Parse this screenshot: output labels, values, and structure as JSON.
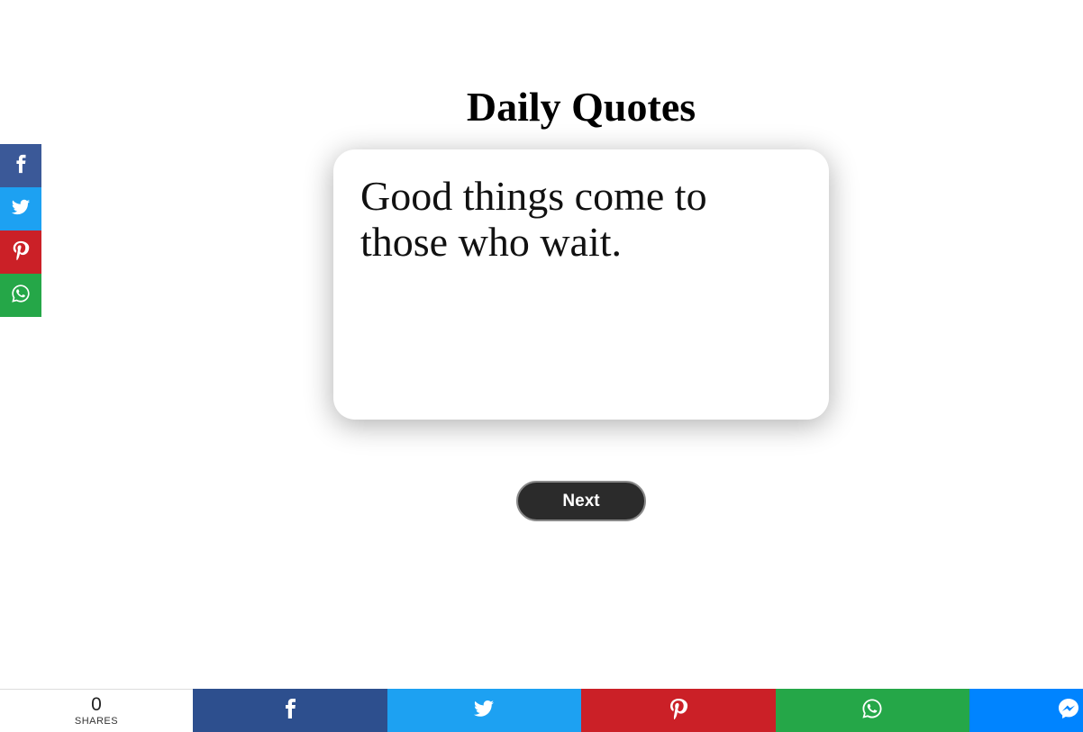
{
  "page": {
    "title": "Daily Quotes",
    "quote": "Good things come to those who wait.",
    "next_label": "Next"
  },
  "side_share": [
    {
      "network": "facebook",
      "icon": "facebook-icon",
      "color": "#3b5998"
    },
    {
      "network": "twitter",
      "icon": "twitter-icon",
      "color": "#1da1f2"
    },
    {
      "network": "pinterest",
      "icon": "pinterest-icon",
      "color": "#cb2027"
    },
    {
      "network": "whatsapp",
      "icon": "whatsapp-icon",
      "color": "#25a748"
    }
  ],
  "share_bar": {
    "count": "0",
    "count_label": "SHARES",
    "buttons": [
      {
        "network": "facebook",
        "icon": "facebook-icon",
        "color": "#2d4f8e"
      },
      {
        "network": "twitter",
        "icon": "twitter-icon",
        "color": "#1da1f2"
      },
      {
        "network": "pinterest",
        "icon": "pinterest-icon",
        "color": "#cb2027"
      },
      {
        "network": "whatsapp",
        "icon": "whatsapp-icon",
        "color": "#25a748"
      },
      {
        "network": "messenger",
        "icon": "messenger-icon",
        "color": "#0084ff"
      }
    ]
  }
}
